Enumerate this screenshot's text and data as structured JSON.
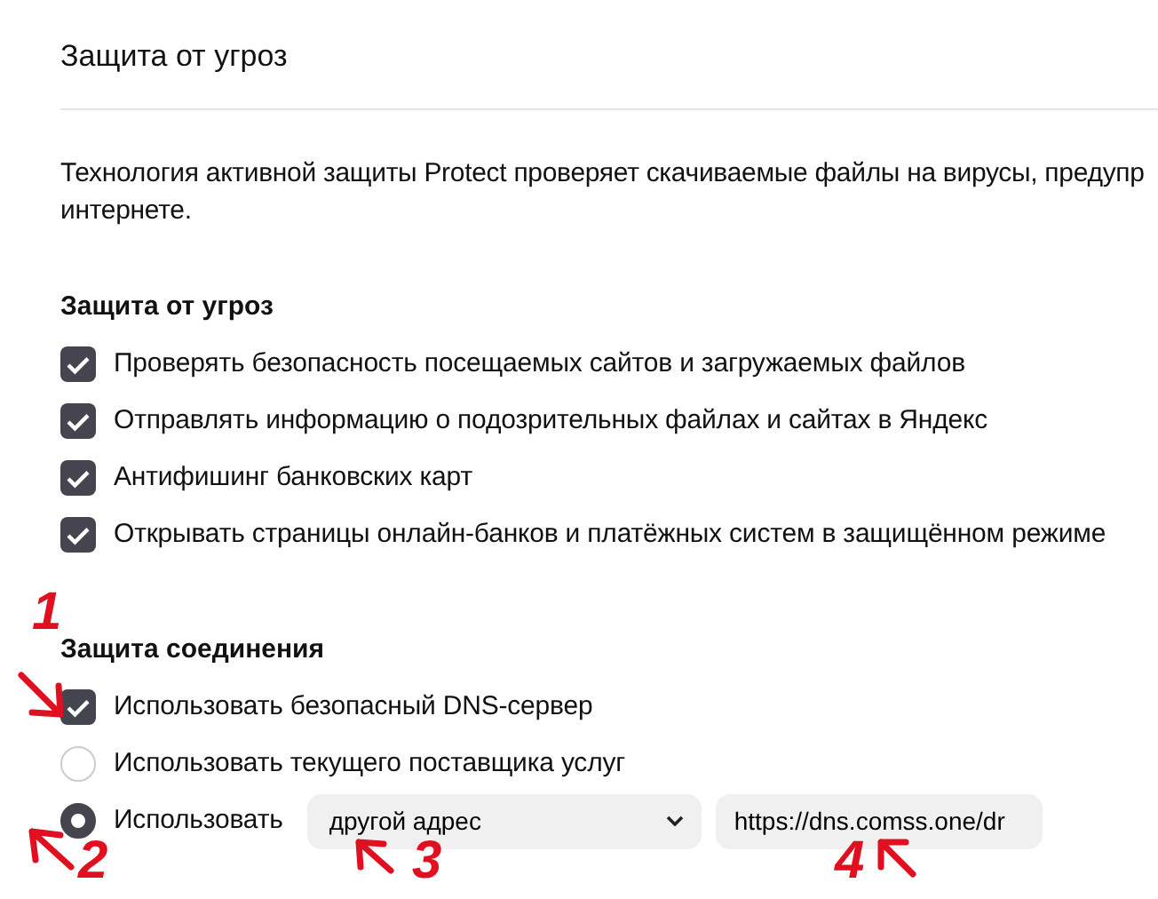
{
  "page_title": "Защита от угроз",
  "description_lines": [
    "Технология активной защиты Protect проверяет скачиваемые файлы на вирусы, предупр",
    "интернете."
  ],
  "sections": [
    {
      "heading": "Защита от угроз",
      "options": [
        {
          "kind": "checkbox",
          "label": "Проверять безопасность посещаемых сайтов и загружаемых файлов",
          "checked": true
        },
        {
          "kind": "checkbox",
          "label": "Отправлять информацию о подозрительных файлах и сайтах в Яндекс",
          "checked": true
        },
        {
          "kind": "checkbox",
          "label": "Антифишинг банковских карт",
          "checked": true
        },
        {
          "kind": "checkbox",
          "label": "Открывать страницы онлайн-банков и платёжных систем в защищённом режиме",
          "checked": true
        }
      ]
    },
    {
      "heading": "Защита соединения",
      "options": [
        {
          "kind": "checkbox",
          "label": "Использовать безопасный DNS-сервер",
          "checked": true
        },
        {
          "kind": "radio",
          "label": "Использовать текущего поставщика услуг",
          "selected": false
        },
        {
          "kind": "radio",
          "label": "Использовать",
          "selected": true,
          "select": {
            "value": "другой адрес"
          },
          "url": {
            "value": "https://dns.comss.one/dr"
          }
        }
      ]
    }
  ],
  "annotations": [
    {
      "label": "1"
    },
    {
      "label": "2"
    },
    {
      "label": "3"
    },
    {
      "label": "4"
    }
  ]
}
